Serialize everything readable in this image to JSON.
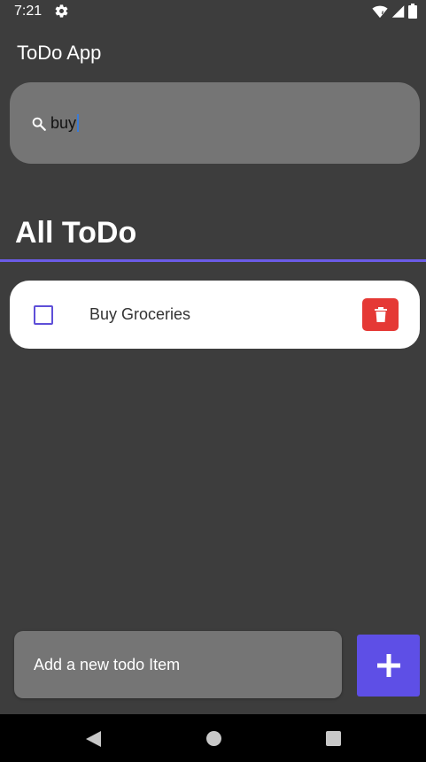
{
  "status_bar": {
    "time": "7:21",
    "icons": [
      "settings-icon",
      "wifi-icon",
      "signal-icon",
      "battery-icon"
    ]
  },
  "app": {
    "title": "ToDo App"
  },
  "search": {
    "icon": "search-icon",
    "value": "buy"
  },
  "section": {
    "title": "All ToDo"
  },
  "todos": [
    {
      "label": "Buy Groceries",
      "checked": false,
      "delete_icon": "trash-icon"
    }
  ],
  "new_todo": {
    "placeholder": "Add a new todo Item",
    "add_icon": "plus-icon"
  },
  "nav_bar": {
    "icons": [
      "back-icon",
      "home-icon",
      "recents-icon"
    ]
  },
  "colors": {
    "background": "#3d3d3d",
    "accent": "#5e4fe6",
    "divider": "#6b5ce7",
    "search_bg": "#757575",
    "card_bg": "#ffffff",
    "delete": "#e53935",
    "nav_bg": "#000000"
  }
}
